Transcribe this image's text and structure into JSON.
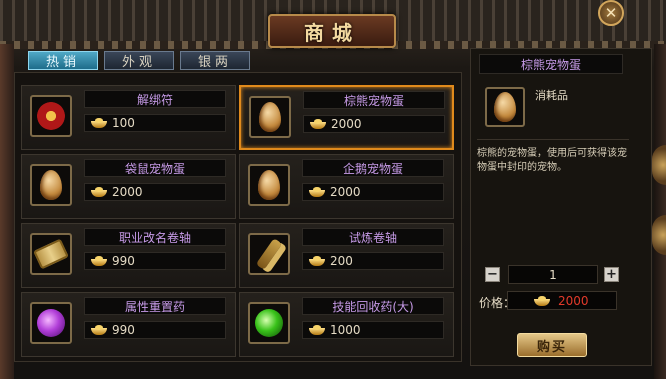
{
  "window": {
    "title": "商城",
    "close_label": "✕"
  },
  "tabs": [
    {
      "label": "热销",
      "active": true
    },
    {
      "label": "外观",
      "active": false
    },
    {
      "label": "银两",
      "active": false
    }
  ],
  "items": [
    {
      "name": "解绑符",
      "price": "100",
      "icon": "talisman-icon",
      "selected": false
    },
    {
      "name": "棕熊宠物蛋",
      "price": "2000",
      "icon": "egg-icon",
      "selected": true
    },
    {
      "name": "袋鼠宠物蛋",
      "price": "2000",
      "icon": "egg-icon",
      "selected": false
    },
    {
      "name": "企鹅宠物蛋",
      "price": "2000",
      "icon": "egg-icon",
      "selected": false
    },
    {
      "name": "职业改名卷轴",
      "price": "990",
      "icon": "scroll-icon",
      "selected": false
    },
    {
      "name": "试炼卷轴",
      "price": "200",
      "icon": "scroll-icon",
      "selected": false
    },
    {
      "name": "属性重置药",
      "price": "990",
      "icon": "potion-icon",
      "selected": false
    },
    {
      "name": "技能回收药(大)",
      "price": "1000",
      "icon": "potion-icon",
      "selected": false
    }
  ],
  "detail": {
    "name": "棕熊宠物蛋",
    "type": "消耗品",
    "description": "棕熊的宠物蛋，使用后可获得该宠物蛋中封印的宠物。",
    "quantity": "1",
    "minus_label": "−",
    "plus_label": "+",
    "price_label": "价格：",
    "total": "2000",
    "buy_label": "购买"
  },
  "colors": {
    "item_name": "#c79be8",
    "selected_border": "#e08a1c",
    "total_price": "#e23a2a",
    "active_tab": "#4fa8c6"
  }
}
